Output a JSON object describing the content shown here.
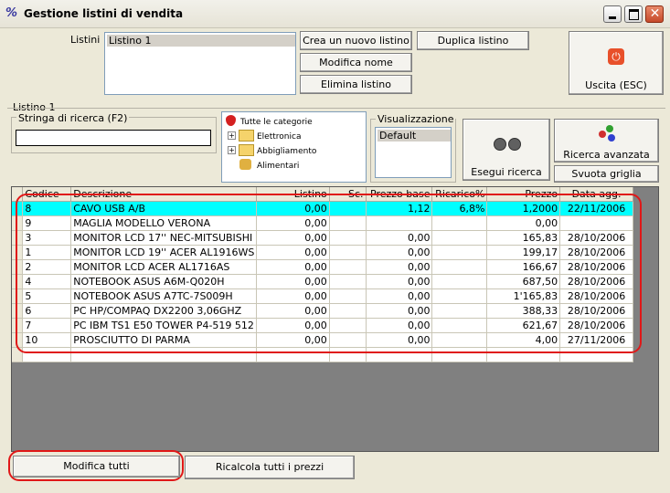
{
  "window": {
    "title": "Gestione listini di vendita"
  },
  "listini": {
    "label": "Listini :",
    "items": [
      "Listino 1"
    ],
    "buttons": {
      "new": "Crea un nuovo listino",
      "rename": "Modifica nome",
      "delete": "Elimina listino",
      "duplicate": "Duplica listino",
      "exit": "Uscita (ESC)"
    }
  },
  "section": {
    "title": "Listino 1"
  },
  "search": {
    "label": "Stringa di ricerca (F2)",
    "value": ""
  },
  "categories": {
    "root": "Tutte le categorie",
    "items": [
      "Elettronica",
      "Abbigliamento",
      "Alimentari"
    ]
  },
  "view": {
    "label": "Visualizzazione",
    "items": [
      "Default"
    ]
  },
  "actions": {
    "search": "Esegui ricerca",
    "advanced": "Ricerca avanzata",
    "clear": "Svuota griglia"
  },
  "grid": {
    "columns": [
      "Codice",
      "Descrizione",
      "Listino",
      "Sc.",
      "Prezzo base",
      "Ricarico%",
      "Prezzo",
      "Data agg."
    ],
    "rows": [
      [
        "8",
        "CAVO USB A/B",
        "0,00",
        "",
        "1,12",
        "6,8%",
        "1,2000",
        "22/11/2006"
      ],
      [
        "9",
        "MAGLIA MODELLO VERONA",
        "0,00",
        "",
        "",
        "",
        "0,00",
        ""
      ],
      [
        "3",
        "MONITOR LCD 17'' NEC-MITSUBISHI",
        "0,00",
        "",
        "0,00",
        "",
        "165,83",
        "28/10/2006"
      ],
      [
        "1",
        "MONITOR LCD 19'' ACER AL1916WS",
        "0,00",
        "",
        "0,00",
        "",
        "199,17",
        "28/10/2006"
      ],
      [
        "2",
        "MONITOR LCD ACER AL1716AS",
        "0,00",
        "",
        "0,00",
        "",
        "166,67",
        "28/10/2006"
      ],
      [
        "4",
        "NOTEBOOK ASUS A6M-Q020H",
        "0,00",
        "",
        "0,00",
        "",
        "687,50",
        "28/10/2006"
      ],
      [
        "5",
        "NOTEBOOK ASUS A7TC-7S009H",
        "0,00",
        "",
        "0,00",
        "",
        "1'165,83",
        "28/10/2006"
      ],
      [
        "6",
        "PC HP/COMPAQ DX2200 3,06GHZ",
        "0,00",
        "",
        "0,00",
        "",
        "388,33",
        "28/10/2006"
      ],
      [
        "7",
        "PC IBM TS1 E50 TOWER P4-519 512",
        "0,00",
        "",
        "0,00",
        "",
        "621,67",
        "28/10/2006"
      ],
      [
        "10",
        "PROSCIUTTO DI PARMA",
        "0,00",
        "",
        "0,00",
        "",
        "4,00",
        "27/11/2006"
      ]
    ]
  },
  "bottom": {
    "edit_all": "Modifica tutti",
    "recalc": "Ricalcola tutti i prezzi"
  },
  "colors": {
    "highlight_row": "#00ffff",
    "annotation": "#e01818"
  }
}
